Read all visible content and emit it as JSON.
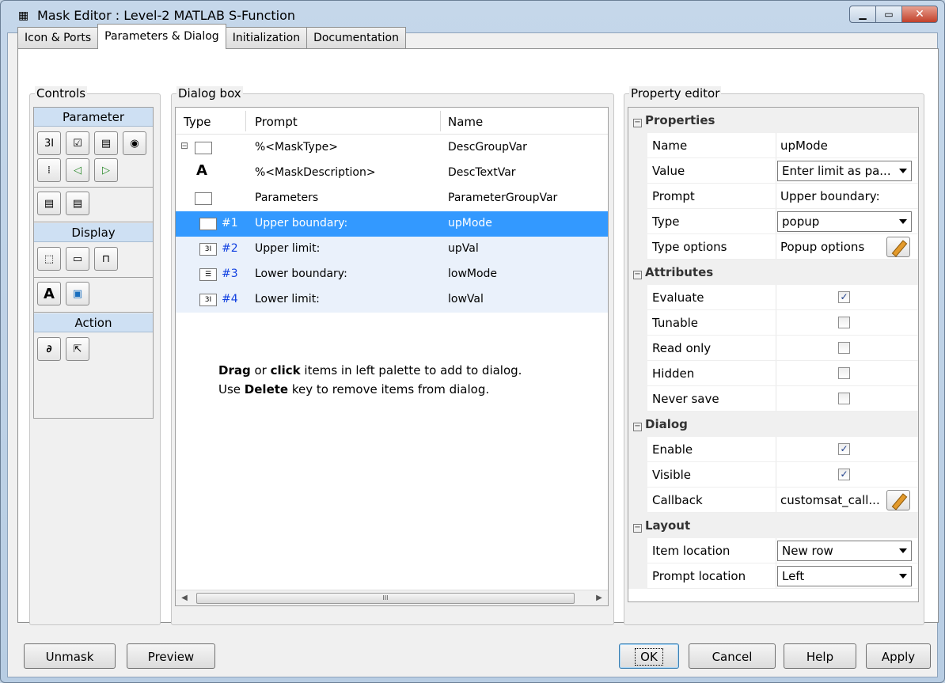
{
  "window": {
    "title": "Mask Editor : Level-2 MATLAB S-Function",
    "icon": "mask-editor-icon",
    "buttons": [
      "minimize",
      "maximize",
      "close"
    ]
  },
  "tabs": [
    {
      "label": "Icon & Ports",
      "active": false
    },
    {
      "label": "Parameters & Dialog",
      "active": true
    },
    {
      "label": "Initialization",
      "active": false
    },
    {
      "label": "Documentation",
      "active": false
    }
  ],
  "controls": {
    "title": "Controls",
    "sections": {
      "parameter": "Parameter",
      "display": "Display",
      "action": "Action"
    }
  },
  "dialog_box": {
    "title": "Dialog box",
    "columns": {
      "type": "Type",
      "prompt": "Prompt",
      "name": "Name"
    },
    "rows": [
      {
        "num": "",
        "prompt": "%<MaskType>",
        "name": "DescGroupVar"
      },
      {
        "num": "",
        "prompt": "%<MaskDescription>",
        "name": "DescTextVar"
      },
      {
        "num": "",
        "prompt": "Parameters",
        "name": "ParameterGroupVar"
      },
      {
        "num": "#1",
        "prompt": "Upper boundary:",
        "name": "upMode"
      },
      {
        "num": "#2",
        "prompt": "Upper limit:",
        "name": "upVal"
      },
      {
        "num": "#3",
        "prompt": "Lower boundary:",
        "name": "lowMode"
      },
      {
        "num": "#4",
        "prompt": "Lower limit:",
        "name": "lowVal"
      }
    ],
    "hint": {
      "line1_a": "Drag",
      "line1_b": " or ",
      "line1_c": "click",
      "line1_d": " items in left palette to add to dialog.",
      "line2_a": "Use ",
      "line2_b": "Delete",
      "line2_c": " key to remove items from dialog."
    },
    "scroll_grip": "III"
  },
  "property_editor": {
    "title": "Property editor",
    "sections": {
      "properties": "Properties",
      "attributes": "Attributes",
      "dialog": "Dialog",
      "layout": "Layout"
    },
    "properties": {
      "name_label": "Name",
      "name_value": "upMode",
      "value_label": "Value",
      "value_value": "Enter limit as pa...",
      "prompt_label": "Prompt",
      "prompt_value": "Upper boundary:",
      "type_label": "Type",
      "type_value": "popup",
      "type_options_label": "Type options",
      "type_options_value": "Popup options"
    },
    "attributes": {
      "evaluate_label": "Evaluate",
      "evaluate": true,
      "tunable_label": "Tunable",
      "tunable": false,
      "read_only_label": "Read only",
      "read_only": false,
      "hidden_label": "Hidden",
      "hidden": false,
      "never_save_label": "Never save",
      "never_save": false
    },
    "dialog": {
      "enable_label": "Enable",
      "enable": true,
      "visible_label": "Visible",
      "visible": true,
      "callback_label": "Callback",
      "callback_value": "customsat_call..."
    },
    "layout": {
      "item_location_label": "Item location",
      "item_location_value": "New row",
      "prompt_location_label": "Prompt location",
      "prompt_location_value": "Left"
    }
  },
  "footer": {
    "unmask": "Unmask",
    "preview": "Preview",
    "ok": "OK",
    "cancel": "Cancel",
    "help": "Help",
    "apply": "Apply"
  },
  "colors": {
    "selection": "#3399ff",
    "row_tint": "#eaf1fb",
    "section_header": "#cee0f3",
    "row_number": "#0f3fe0"
  }
}
